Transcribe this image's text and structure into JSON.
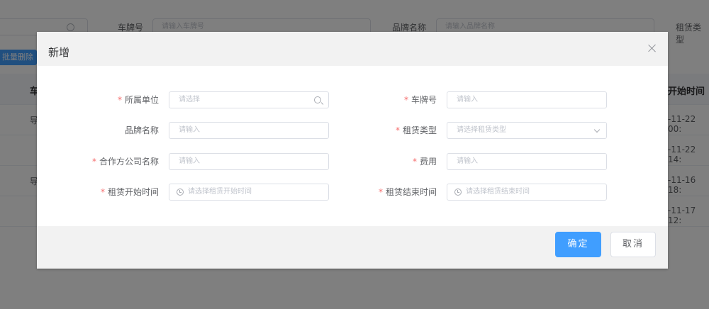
{
  "background": {
    "filters": {
      "plate_label": "车牌号",
      "plate_placeholder": "请输入车牌号",
      "brand_label": "品牌名称",
      "brand_placeholder": "请输入品牌名称",
      "lease_type_label": "租赁类型"
    },
    "batch_delete_label": "批量删除",
    "table": {
      "col_plate_partial": "车",
      "col_start_time_partial": "开始时间",
      "rows": [
        {
          "plate_partial": "导",
          "start_time_partial": "-11-22 00:"
        },
        {
          "plate_partial": "",
          "start_time_partial": "-11-22 14:"
        },
        {
          "plate_partial": "导",
          "start_time_partial": "-11-16 18:"
        },
        {
          "plate_partial": "",
          "start_time_partial": "-11-17 12:"
        }
      ]
    }
  },
  "dialog": {
    "title": "新增",
    "fields": {
      "unit": {
        "label": "所属单位",
        "placeholder": "请选择",
        "required": true
      },
      "plate": {
        "label": "车牌号",
        "placeholder": "请输入",
        "required": true
      },
      "brand": {
        "label": "品牌名称",
        "placeholder": "请输入",
        "required": false
      },
      "lease_type": {
        "label": "租赁类型",
        "placeholder": "请选择租赁类型",
        "required": true
      },
      "partner": {
        "label": "合作方公司名称",
        "placeholder": "请输入",
        "required": true
      },
      "cost": {
        "label": "费用",
        "placeholder": "请输入",
        "required": true
      },
      "start_time": {
        "label": "租赁开始时间",
        "placeholder": "请选择租赁开始时间",
        "required": true
      },
      "end_time": {
        "label": "租赁结束时间",
        "placeholder": "请选择租赁结束时间",
        "required": true
      }
    },
    "required_mark": "*",
    "confirm_label": "确定",
    "cancel_label": "取消"
  },
  "colors": {
    "primary": "#409eff",
    "required": "#f56c6c",
    "mask": "rgba(0,0,0,0.5)"
  },
  "icons": [
    "search-icon",
    "chevron-down-icon",
    "clock-icon",
    "close-icon"
  ]
}
